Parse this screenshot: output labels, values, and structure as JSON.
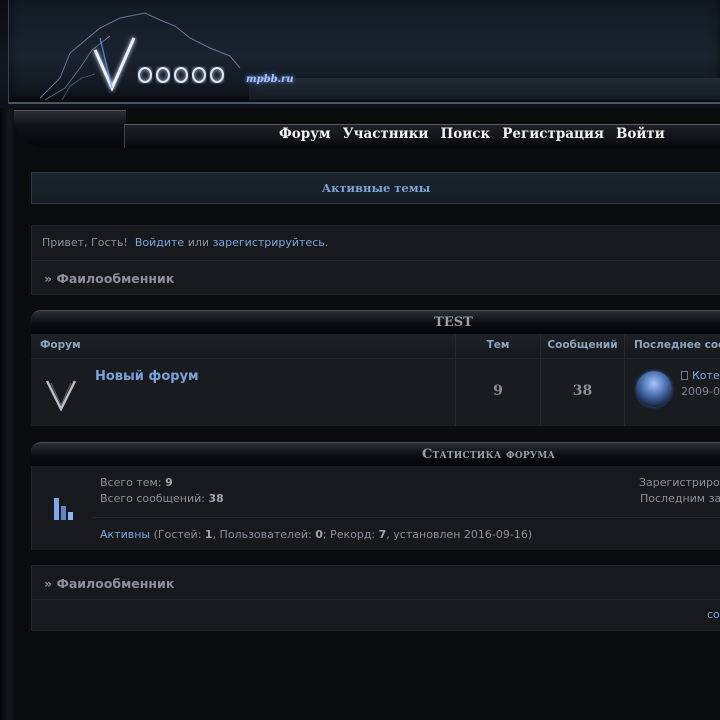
{
  "header": {
    "logo_text": "Voodoo",
    "logo_sub": "mpbb.ru"
  },
  "nav": {
    "items": [
      {
        "label": "Форум"
      },
      {
        "label": "Участники"
      },
      {
        "label": "Поиск"
      },
      {
        "label": "Регистрация"
      },
      {
        "label": "Войти"
      }
    ]
  },
  "active_topics": {
    "label": "Активные темы"
  },
  "welcome": {
    "greeting": "Привет, Гость!",
    "login_link": "Войдите",
    "or": "или",
    "register_link": "зарегистрируйтесь",
    "end": "."
  },
  "breadcrumb": {
    "prefix": "»",
    "label": "Фаилообменник"
  },
  "category": {
    "title": "TEST",
    "columns": {
      "forum": "Форум",
      "topics": "Тем",
      "posts": "Сообщений",
      "last_post": "Последнее соо"
    },
    "forums": [
      {
        "name": "Новый форум",
        "topics": "9",
        "posts": "38",
        "last_post_title": "Коте",
        "last_post_date": "2009-0"
      }
    ]
  },
  "stats": {
    "title": "Статистика форума",
    "total_topics_label": "Всего тем:",
    "total_topics": "9",
    "total_posts_label": "Всего сообщений:",
    "total_posts": "38",
    "registered_label": "Зарегистриров",
    "last_registered_label": "Последним за",
    "active_link": "Активны",
    "online_open": "(Гостей:",
    "guests": "1",
    "users_label": ", Пользователей:",
    "users": "0",
    "record_label": "; Рекорд:",
    "record": "7",
    "record_date_label": ", установлен 2016-09-16)"
  },
  "bottom": {
    "breadcrumb_prefix": "»",
    "breadcrumb_label": "Фаилообменник",
    "link": "со"
  },
  "colors": {
    "accent": "#79a3dc",
    "background": "#0b0c0e",
    "panel": "#17191c"
  }
}
